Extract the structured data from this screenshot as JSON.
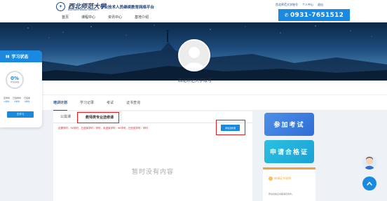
{
  "header": {
    "school_name": "西北师范大学",
    "school_name_en": "NORTHWEST NORMAL UNIVERSITY",
    "platform_title": "专业技术人员继续教育网络平台",
    "nav": [
      "首页",
      "课程中心",
      "资讯中心",
      "基地介绍"
    ],
    "user_links": [
      "西北师范大学账号",
      "个人中心",
      "退出"
    ],
    "phone": "0931-7651512"
  },
  "status_card": {
    "title": "学习状态",
    "percent": "0%",
    "percent_label": "学习总进度",
    "stats": [
      {
        "label": "应学时",
        "value": "0学时"
      },
      {
        "label": "已选学时",
        "value": "0学时"
      },
      {
        "label": "已完成",
        "value": "0学时"
      }
    ],
    "study_button": "去学习"
  },
  "profile": {
    "username": "西北师范大学账号"
  },
  "tabs": [
    "培训计划",
    "学习记录",
    "考试",
    "证书查询"
  ],
  "tabs_active": 0,
  "content": {
    "sub_tabs": [
      "公需课",
      "教师类专业选修课"
    ],
    "sub_tabs_active": 1,
    "stats_line": "应需学时：90学时，已选择学时：学时，未选择学时：90学时，已完成学时：学时",
    "add_button": "添加选修课",
    "empty_text": "暂时没有内容"
  },
  "side": {
    "exam_button": "参加考试",
    "cert_button": "申请合格证",
    "cert_info_title": "申请证书说明",
    "cert_info_line": "申请合格证书需满足条件。"
  },
  "colors": {
    "primary": "#1a8ae0",
    "highlight": "#e02020",
    "accent": "#f0a437"
  }
}
